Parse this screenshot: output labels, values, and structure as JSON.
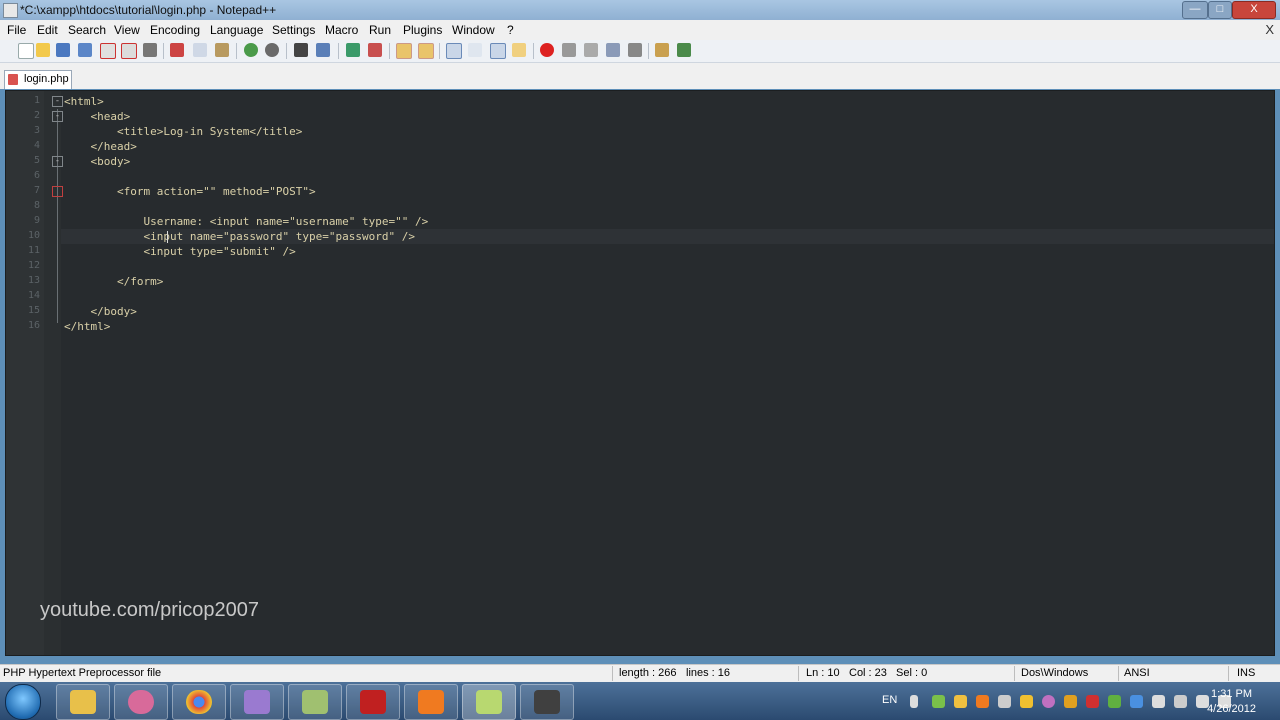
{
  "window": {
    "title": "*C:\\xampp\\htdocs\\tutorial\\login.php - Notepad++",
    "controls": {
      "minimize": "—",
      "maximize": "□",
      "close": "X"
    }
  },
  "menu": {
    "items": [
      "File",
      "Edit",
      "Search",
      "View",
      "Encoding",
      "Language",
      "Settings",
      "Macro",
      "Run",
      "Plugins",
      "Window",
      "?"
    ],
    "close": "X"
  },
  "tab": {
    "label": "login.php"
  },
  "editor": {
    "line_numbers": [
      "1",
      "2",
      "3",
      "4",
      "5",
      "6",
      "7",
      "8",
      "9",
      "10",
      "11",
      "12",
      "13",
      "14",
      "15",
      "16"
    ],
    "lines": [
      "<html>",
      "    <head>",
      "        <title>Log-in System</title>",
      "    </head>",
      "    <body>",
      "",
      "        <form action=\"\" method=\"POST\">",
      "",
      "            Username: <input name=\"username\" type=\"\" />",
      "            <input name=\"password\" type=\"password\" />",
      "            <input type=\"submit\" />",
      "",
      "        </form>",
      "",
      "    </body>",
      "</html>"
    ],
    "fold_markers": [
      "-",
      "-",
      "-"
    ]
  },
  "watermark": "youtube.com/pricop2007",
  "status": {
    "file_type": "PHP Hypertext Preprocessor file",
    "length": "length : 266",
    "lines": "lines : 16",
    "ln": "Ln : 10",
    "col": "Col : 23",
    "sel": "Sel : 0",
    "eol": "Dos\\Windows",
    "encoding": "ANSI",
    "mode": "INS"
  },
  "taskbar": {
    "lang": "EN",
    "time": "1:31 PM",
    "date": "4/26/2012",
    "apps": [
      "explorer",
      "app-2",
      "chrome",
      "app-4",
      "app-5",
      "filezilla",
      "xampp",
      "notepad-plus-plus",
      "app-9"
    ]
  },
  "colors": {
    "editor_bg": "#272b2e",
    "code_text": "#d9d0a8",
    "taskbar": "#2b4a70"
  }
}
